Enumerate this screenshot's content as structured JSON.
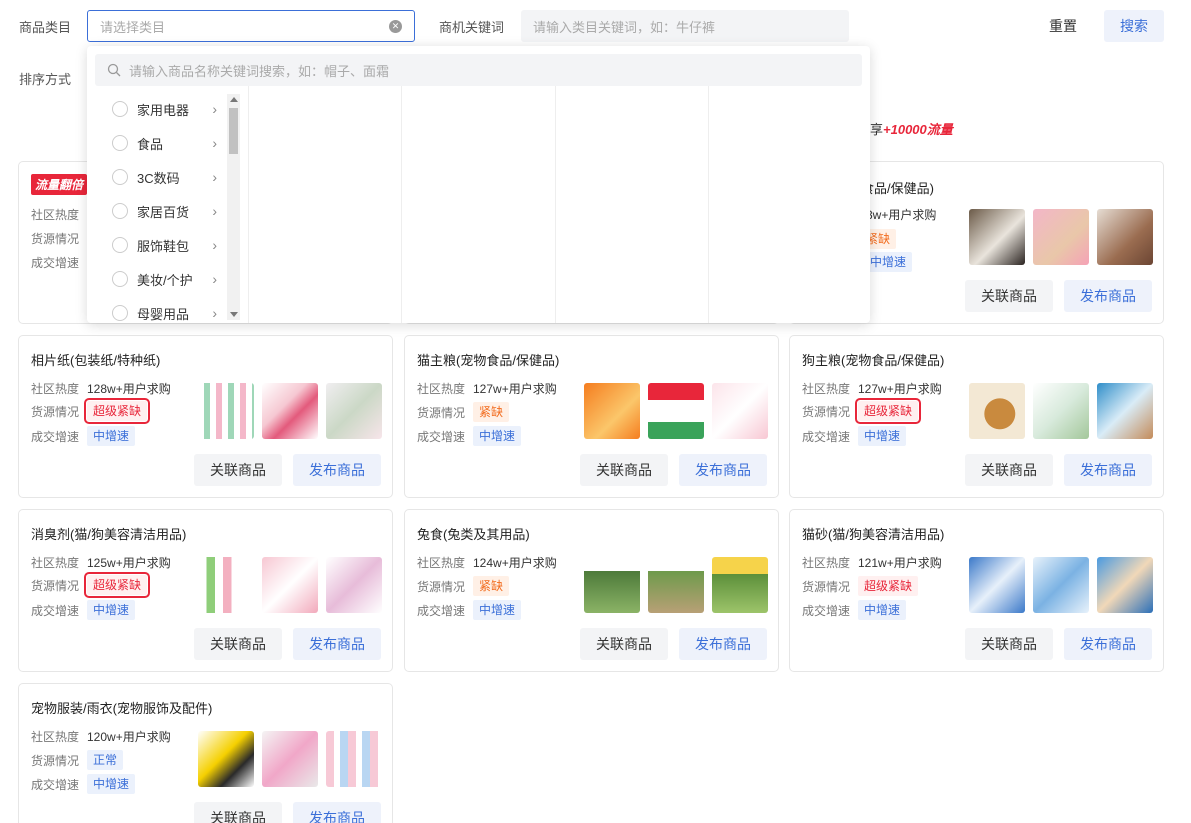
{
  "filters": {
    "category_label": "商品类目",
    "category_placeholder": "请选择类目",
    "keyword_label": "商机关键词",
    "keyword_placeholder": "请输入类目关键词，如：牛仔裤",
    "sort_label": "排序方式",
    "reset": "重置",
    "search": "搜索"
  },
  "promo": {
    "prefix": "享",
    "highlight": "+10000流量"
  },
  "dropdown": {
    "search_placeholder": "请输入商品名称关键词搜索，如：帽子、面霜",
    "categories": [
      "家用电器",
      "食品",
      "3C数码",
      "家居百货",
      "服饰鞋包",
      "美妆/个护",
      "母婴用品"
    ]
  },
  "labels": {
    "heat": "社区热度",
    "supply": "货源情况",
    "growth": "成交增速",
    "related": "关联商品",
    "publish": "发布商品",
    "hot_badge": "流量翻倍"
  },
  "cards": [
    {
      "title": "",
      "heat": "",
      "supply": "",
      "growth": ""
    },
    {
      "title": "",
      "heat": "",
      "supply": "",
      "growth": ""
    },
    {
      "title": "物食品/保健品)",
      "heat": "3w+用户求购",
      "supply": "紧缺",
      "growth": "中增速"
    },
    {
      "title": "相片纸(包装纸/特种纸)",
      "heat": "128w+用户求购",
      "supply": "超级紧缺",
      "growth": "中增速"
    },
    {
      "title": "猫主粮(宠物食品/保健品)",
      "heat": "127w+用户求购",
      "supply": "紧缺",
      "growth": "中增速"
    },
    {
      "title": "狗主粮(宠物食品/保健品)",
      "heat": "127w+用户求购",
      "supply": "超级紧缺",
      "growth": "中增速"
    },
    {
      "title": "消臭剂(猫/狗美容清洁用品)",
      "heat": "125w+用户求购",
      "supply": "超级紧缺",
      "growth": "中增速"
    },
    {
      "title": "兔食(兔类及其用品)",
      "heat": "124w+用户求购",
      "supply": "紧缺",
      "growth": "中增速"
    },
    {
      "title": "猫砂(猫/狗美容清洁用品)",
      "heat": "121w+用户求购",
      "supply": "超级紧缺",
      "growth": "中增速"
    },
    {
      "title": "宠物服装/雨衣(宠物服饰及配件)",
      "heat": "120w+用户求购",
      "supply": "正常",
      "growth": "中增速"
    }
  ],
  "colors": {
    "accent": "#3b6fd8",
    "danger": "#e8263a",
    "warn": "#f26b1d"
  }
}
